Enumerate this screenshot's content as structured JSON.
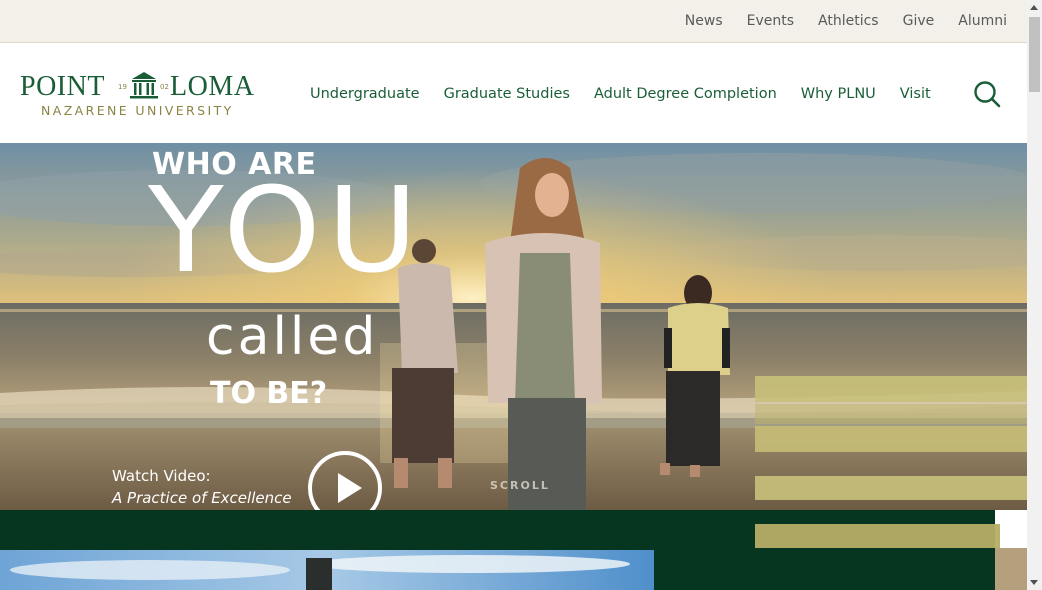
{
  "utility_nav": {
    "items": [
      {
        "label": "News"
      },
      {
        "label": "Events"
      },
      {
        "label": "Athletics"
      },
      {
        "label": "Give"
      },
      {
        "label": "Alumni"
      }
    ]
  },
  "logo": {
    "word_left": "POINT",
    "word_right": "LOMA",
    "year_left": "19",
    "year_right": "02",
    "subtitle": "NAZARENE UNIVERSITY"
  },
  "main_nav": {
    "items": [
      {
        "label": "Undergraduate"
      },
      {
        "label": "Graduate Studies"
      },
      {
        "label": "Adult Degree Completion"
      },
      {
        "label": "Why PLNU"
      },
      {
        "label": "Visit"
      }
    ],
    "search_icon": "search-icon"
  },
  "hero": {
    "headline_line1": "WHO ARE",
    "headline_line2": "YOU",
    "headline_line3": "called",
    "headline_line4": "TO BE?",
    "video_label": "Watch Video:",
    "video_title": "A Practice of Excellence",
    "scroll_label": "SCROLL",
    "play_icon": "play-icon"
  },
  "colors": {
    "brand_green": "#1a5e38",
    "dark_green": "#063520",
    "gold": "#8a8445",
    "utility_bg": "#f2f0e9"
  }
}
